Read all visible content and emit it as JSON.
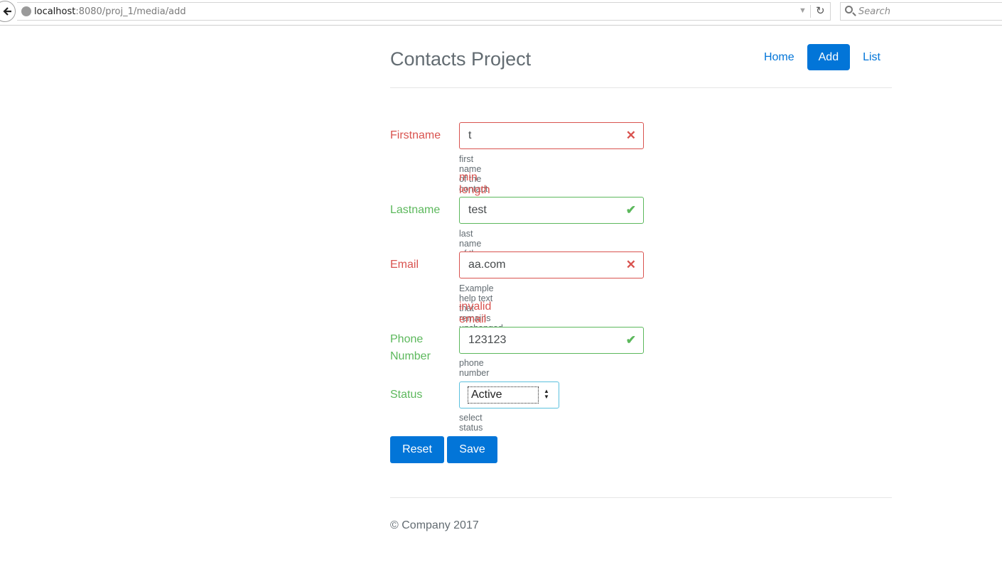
{
  "browser": {
    "url_host": "localhost",
    "url_rest": ":8080/proj_1/media/add",
    "search_placeholder": "Search"
  },
  "header": {
    "brand": "Contacts Project",
    "nav": [
      {
        "label": "Home",
        "active": false
      },
      {
        "label": "Add",
        "active": true
      },
      {
        "label": "List",
        "active": false
      }
    ]
  },
  "form": {
    "firstname": {
      "label": "Firstname",
      "value": "t",
      "help": "first name of the contact",
      "error": "min length is 2",
      "state": "invalid"
    },
    "lastname": {
      "label": "Lastname",
      "value": "test",
      "help": "last name of the contact",
      "state": "valid"
    },
    "email": {
      "label": "Email",
      "value": "aa.com",
      "help": "Example help text that remains unchanged.",
      "error": "invalid email format",
      "state": "invalid"
    },
    "phone": {
      "label": "Phone Number",
      "value": "123123",
      "help": "phone number",
      "state": "valid"
    },
    "status": {
      "label": "Status",
      "value": "Active",
      "help": "select status"
    },
    "buttons": {
      "reset": "Reset",
      "save": "Save"
    }
  },
  "footer": {
    "text": "© Company 2017"
  },
  "colors": {
    "primary": "#0275d8",
    "danger": "#d9534f",
    "success": "#5cb85c"
  }
}
